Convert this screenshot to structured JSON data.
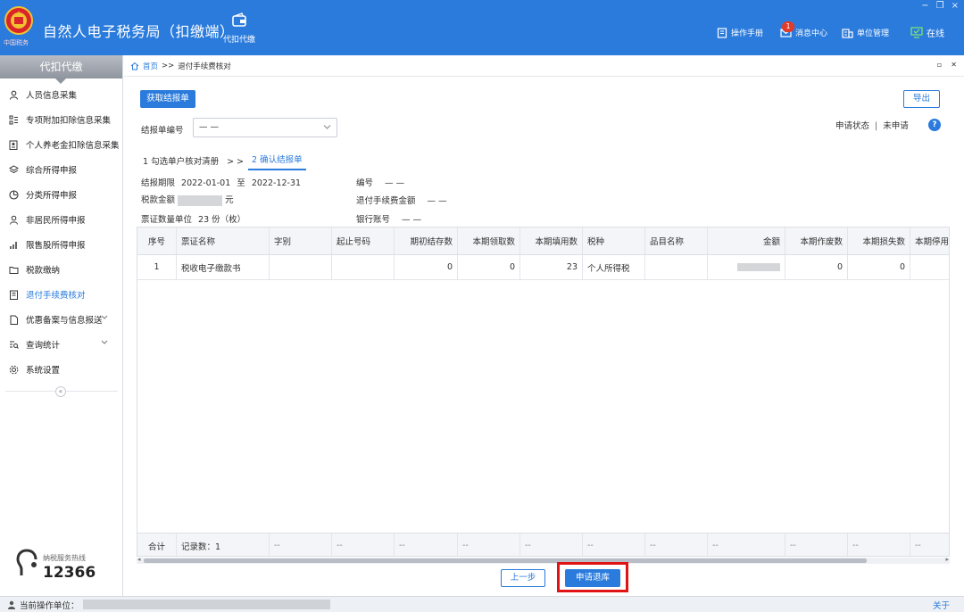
{
  "app": {
    "title": "自然人电子税务局（扣缴端）",
    "emblem_text": "中国税务",
    "module_label": "代扣代缴",
    "window_controls": [
      "−",
      "❐",
      "×"
    ],
    "accent_color": "#2a7bdc"
  },
  "top_menu": {
    "manual": "操作手册",
    "messages": "消息中心",
    "message_badge": "1",
    "unit_mgmt": "单位管理",
    "online": "在线"
  },
  "sidebar": {
    "header": "代扣代缴",
    "items": [
      {
        "label": "人员信息采集",
        "icon": "person-icon"
      },
      {
        "label": "专项附加扣除信息采集",
        "icon": "list-grid-icon"
      },
      {
        "label": "个人养老金扣除信息采集",
        "icon": "document-person-icon"
      },
      {
        "label": "综合所得申报",
        "icon": "layers-icon"
      },
      {
        "label": "分类所得申报",
        "icon": "pie-clock-icon"
      },
      {
        "label": "非居民所得申报",
        "icon": "person-outline-icon"
      },
      {
        "label": "限售股所得申报",
        "icon": "bar-chart-icon"
      },
      {
        "label": "税款缴纳",
        "icon": "folder-icon"
      },
      {
        "label": "退付手续费核对",
        "icon": "receipt-icon",
        "active": true
      },
      {
        "label": "优惠备案与信息报送",
        "icon": "file-icon",
        "expandable": true
      },
      {
        "label": "查询统计",
        "icon": "search-list-icon",
        "expandable": true
      },
      {
        "label": "系统设置",
        "icon": "gear-icon"
      }
    ],
    "collapse_glyph": "«",
    "hotline_label": "纳税服务热线",
    "hotline_number": "12366"
  },
  "breadcrumb": {
    "home": "首页",
    "separator": ">>",
    "current": "退付手续费核对"
  },
  "toolbar": {
    "get_report_button": "获取结报单",
    "export_button": "导出"
  },
  "filter": {
    "report_no_label": "结报单编号",
    "report_no_value": "— —",
    "apply_status_label": "申请状态",
    "apply_status_divider": "|",
    "apply_status_value": "未申请",
    "help_glyph": "?"
  },
  "steps": {
    "step1": "1 勾选单户核对清册",
    "arrow": "> >",
    "step2": "2 确认结报单"
  },
  "info": {
    "period_label": "结报期限",
    "period_start": "2022-01-01",
    "period_to": "至",
    "period_end": "2022-12-31",
    "number_label": "编号",
    "number_value": "— —",
    "tax_amount_label": "税款金额",
    "tax_amount_unit": "元",
    "refund_fee_label": "退付手续费金额",
    "refund_fee_value": "— —",
    "ticket_qty_label": "票证数量单位",
    "ticket_qty_value": "23 份（枚）",
    "bank_account_label": "银行账号",
    "bank_account_value": "— —"
  },
  "table": {
    "headers": [
      "序号",
      "票证名称",
      "字别",
      "起止号码",
      "期初结存数",
      "本期领取数",
      "本期填用数",
      "税种",
      "品目名称",
      "金额",
      "本期作废数",
      "本期损失数",
      "本期停用"
    ],
    "rows": [
      [
        "1",
        "税收电子缴款书",
        "",
        "",
        "0",
        "0",
        "23",
        "个人所得税",
        "",
        "",
        "0",
        "0",
        ""
      ]
    ],
    "footer": {
      "total_label": "合计",
      "record_count": "记录数：1",
      "placeholder": "--"
    }
  },
  "actions": {
    "prev_button": "上一步",
    "apply_button": "申请退库"
  },
  "statusbar": {
    "operator_label": "当前操作单位：",
    "about": "关于"
  }
}
